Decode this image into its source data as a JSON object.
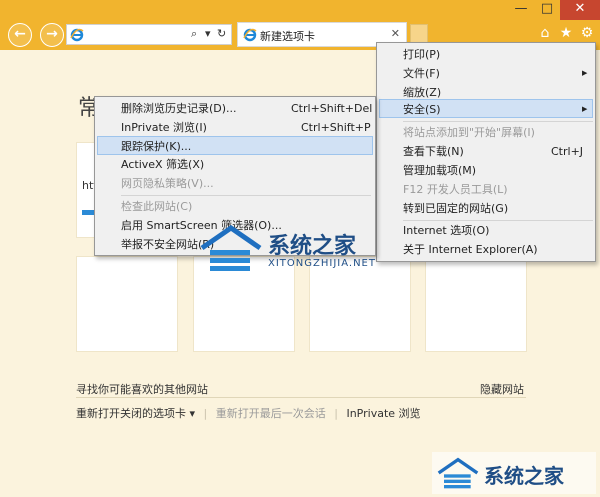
{
  "window": {
    "minimize_glyph": "—",
    "maximize_glyph": "□",
    "close_glyph": "✕"
  },
  "nav": {
    "back_glyph": "←",
    "forward_glyph": "→",
    "search_glyph": "⌕",
    "dropdown_glyph": "▾",
    "refresh_glyph": "↻"
  },
  "tab": {
    "label": "新建选项卡",
    "close_glyph": "✕"
  },
  "toolbar_icons": [
    {
      "name": "home-icon",
      "glyph": "⌂"
    },
    {
      "name": "favorites-star-icon",
      "glyph": "★"
    },
    {
      "name": "tools-gear-icon",
      "glyph": "⚙"
    }
  ],
  "page": {
    "title_fragment": "常用",
    "url_fragment": "htt",
    "find_sites": "寻找你可能喜欢的其他网站",
    "hide_sites": "隐藏网站",
    "reopen_closed": "重新打开关闭的选项卡 ▾",
    "sep": "|",
    "reopen_last": "重新打开最后一次会话",
    "inprivate": "InPrivate 浏览"
  },
  "tools_menu": {
    "items": [
      {
        "label": "打印(P)",
        "disabled": false
      },
      {
        "label": "文件(F)",
        "arrow": true
      },
      {
        "label": "缩放(Z)",
        "disabled": false
      },
      {
        "label": "安全(S)",
        "arrow": true,
        "highlighted": true
      },
      {
        "label": "将站点添加到\"开始\"屏幕(I)",
        "disabled": true
      },
      {
        "label": "查看下载(N)",
        "shortcut": "Ctrl+J"
      },
      {
        "label": "管理加载项(M)"
      },
      {
        "label": "F12 开发人员工具(L)",
        "disabled": true
      },
      {
        "label": "转到已固定的网站(G)"
      },
      {
        "label": "Internet 选项(O)"
      },
      {
        "label": "关于 Internet Explorer(A)"
      }
    ],
    "arrow_glyph": "▶"
  },
  "safety_menu": {
    "items": [
      {
        "label": "删除浏览历史记录(D)...",
        "shortcut": "Ctrl+Shift+Del"
      },
      {
        "label": "InPrivate 浏览(I)",
        "shortcut": "Ctrl+Shift+P"
      },
      {
        "label": "跟踪保护(K)...",
        "highlighted": true
      },
      {
        "label": "ActiveX 筛选(X)"
      },
      {
        "label": "网页隐私策略(V)...",
        "disabled": true
      },
      {
        "label": "检查此网站(C)",
        "disabled": true
      },
      {
        "label": "启用 SmartScreen 筛选器(O)..."
      },
      {
        "label": "举报不安全网站(R)"
      }
    ]
  },
  "watermark": {
    "brand": "系统之家",
    "domain": "XITONGZHIJIA.NET"
  },
  "colors": {
    "frame": "#f1b42e",
    "content_bg": "#fbf3dd",
    "menu_bg": "#f0f0f0",
    "highlight": "#d1e1f4",
    "accent_blue": "#2b8ad6",
    "close_red": "#c7462f"
  }
}
